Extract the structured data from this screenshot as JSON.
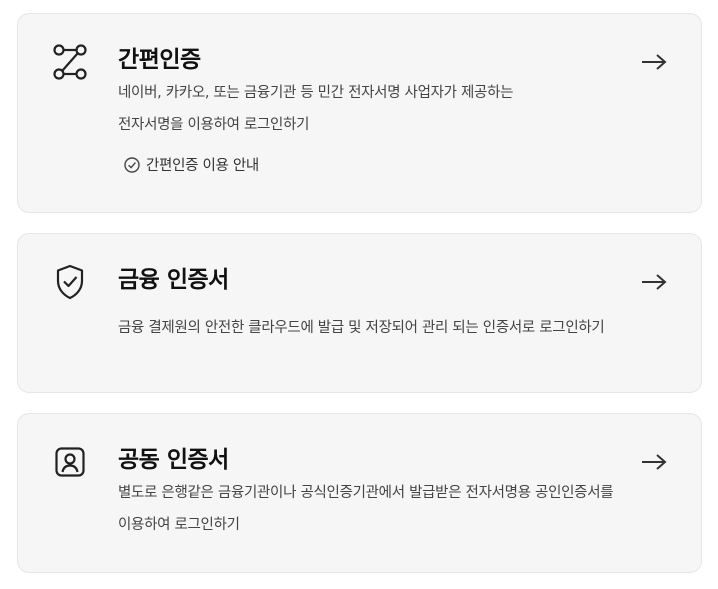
{
  "options": [
    {
      "id": "simple",
      "icon": "route-nodes-icon",
      "title": "간편인증",
      "desc_lines": [
        "네이버, 카카오, 또는 금융기관 등 민간 전자서명 사업자가 제공하는",
        "전자서명을 이용하여 로그인하기"
      ],
      "guide_label": "간편인증 이용 안내",
      "arrow": "arrow-right-icon"
    },
    {
      "id": "financial",
      "icon": "shield-check-icon",
      "title": "금융 인증서",
      "desc_lines": [
        "금융 결제원의 안전한 클라우드에 발급 및 저장되어 관리 되는 인증서로 로그인하기"
      ],
      "arrow": "arrow-right-icon"
    },
    {
      "id": "joint",
      "icon": "user-badge-icon",
      "title": "공동 인증서",
      "desc_lines": [
        "별도로 은행같은 금융기관이나 공식인증기관에서 발급받은 전자서명용 공인인증서를",
        "이용하여 로그인하기"
      ],
      "arrow": "arrow-right-icon"
    }
  ]
}
